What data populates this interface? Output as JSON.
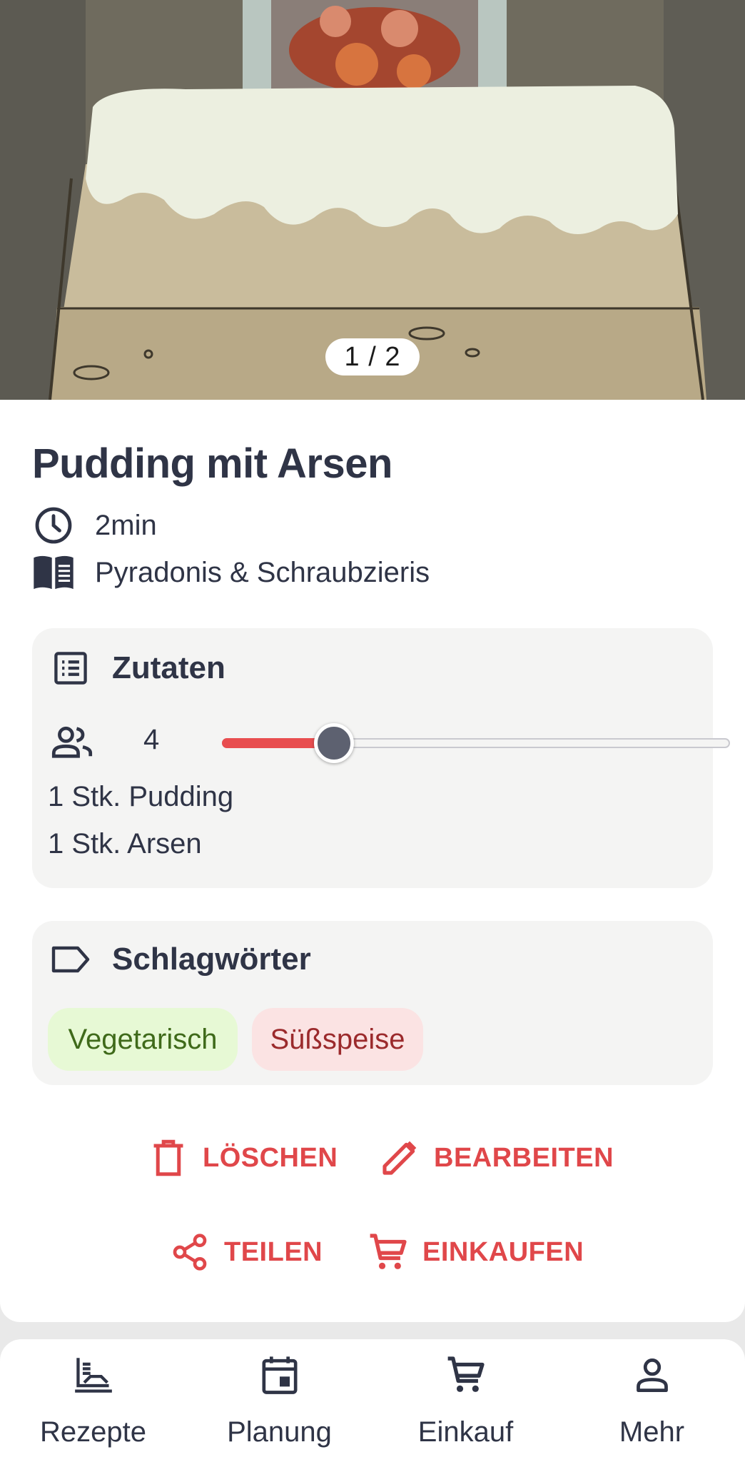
{
  "hero": {
    "pager_text": "1 / 2"
  },
  "recipe": {
    "title": "Pudding mit Arsen",
    "time": "2min",
    "source": "Pyradonis & Schraubzieris"
  },
  "ingredients": {
    "heading": "Zutaten",
    "servings": "4",
    "slider_fraction": 0.22,
    "items": [
      "1 Stk. Pudding",
      "1 Stk. Arsen"
    ]
  },
  "tags": {
    "heading": "Schlagwörter",
    "items": [
      {
        "label": "Vegetarisch",
        "bg": "#e7f9d5",
        "fg": "#3f6a1a"
      },
      {
        "label": "Süßspeise",
        "bg": "#fbe3e3",
        "fg": "#9b2a2c"
      }
    ]
  },
  "actions": {
    "delete": "LÖSCHEN",
    "edit": "BEARBEITEN",
    "share": "TEILEN",
    "shop": "EINKAUFEN"
  },
  "nav": {
    "recipes": "Rezepte",
    "planning": "Planung",
    "shopping": "Einkauf",
    "more": "Mehr"
  },
  "colors": {
    "accent": "#e0474a",
    "text": "#2f3446",
    "card": "#f4f4f3"
  }
}
